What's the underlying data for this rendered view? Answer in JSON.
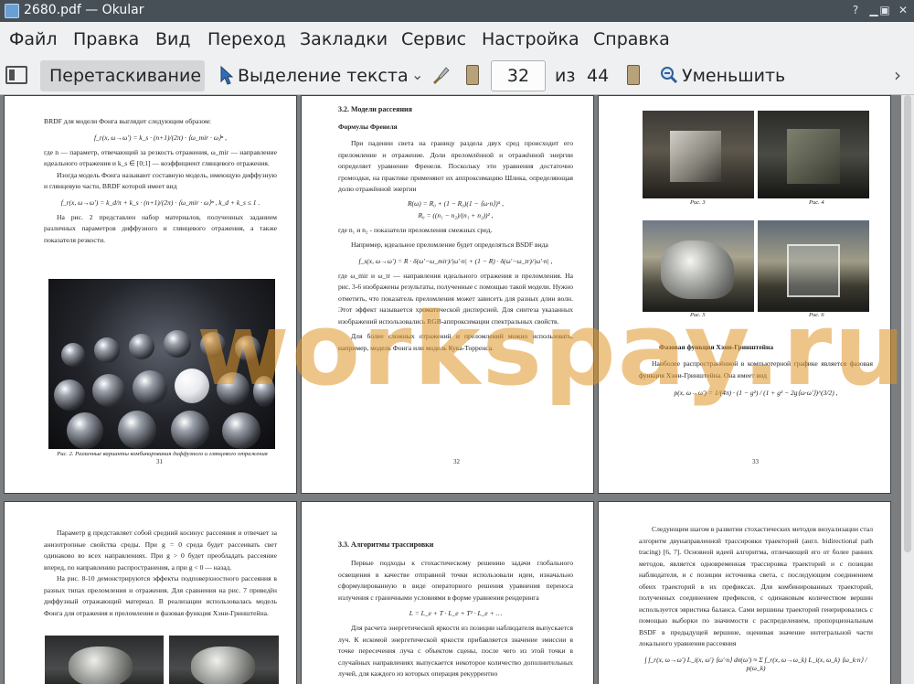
{
  "window": {
    "title": "2680.pdf  — Okular"
  },
  "menu": [
    "Файл",
    "Правка",
    "Вид",
    "Переход",
    "Закладки",
    "Сервис",
    "Настройка",
    "Справка"
  ],
  "toolbar": {
    "drag_label": "Перетаскивание",
    "select_label": "Выделение текста",
    "page_value": "32",
    "of_label": "из",
    "total_pages": "44",
    "zoom_label": "Уменьшить"
  },
  "pages": {
    "p31": {
      "para1": "BRDF для модели Фонга выглядит следующим образом:",
      "formula1": "f_r(x, ω→ω′) = k_s · (n+1)/(2π) · ⟨ω_mir · ω⟩ⁿ ,",
      "para2": "где n — параметр, отвечающий за резкость отражения, ω_mir — направление идеального отражения и k_s ∈ [0;1] — коэффициент глянцевого отражения.",
      "para3": "Изогда модель Фонга называют составную модель, имеющую диффузную и глянцевую части, BRDF которой имеет вид",
      "formula2": "f_r(x, ω→ω′) = k_d/π + k_s · (n+1)/(2π) · ⟨ω_mir · ω⟩ⁿ ,  k_d + k_s ≤ 1 .",
      "para4": "На рис. 2 представлен набор материалов, полученных заданием различных параметров диффузного и глянцевого отражения, а также показателя резкости.",
      "caption": "Рис. 2. Различные варианты комбинирования диффузного и глянцевого отражения",
      "number": "31"
    },
    "p32": {
      "section": "3.2. Модели рассеяния",
      "subsection": "Формулы Френеля",
      "para1": "При падении света на границу раздела двух сред происходит его преломление и отражение. Доли преломлённой и отражённой энергии определяет уравнение Френеля. Поскольку эти уравнения достаточно громоздки, на практике применяют их аппроксимацию Шлика, определяющая долю отражённой энергии",
      "formula1": "R(ω) = R₀ + (1 − R₀)(1 − ⟨ω·n⟩)⁵ ,",
      "formula2": "R₀ = ((n₁ − n₂)/(n₁ + n₂))² ,",
      "para2": "где n₁ и n₂ - показатели преломления смежных сред.",
      "para3": "Например, идеальное преломление будет определяться BSDF вида",
      "formula3": "f_s(x, ω→ω′) = R · δ(ω′−ω_mir)/|ω′·n| + (1 − R) · δ(ω′−ω_tr)/|ω′·n| ,",
      "para4": "где ω_mir и ω_tr — направления идеального отражения и преломления. На рис. 3-6 изображены результаты, полученные с помощью такой модели. Нужно отметить, что показатель преломления может зависеть для разных длин волн. Этот эффект называется хроматической дисперсией. Для синтеза указанных изображений использовались RGB-аппроксимации спектральных свойств.",
      "para5": "Для более сложных отражений и преломлений можно использовать, например, модель Фонга или модель Кука-Торренса.",
      "number": "32"
    },
    "p33": {
      "cap3": "Рис. 3",
      "cap4": "Рис. 4",
      "cap5": "Рис. 5",
      "cap6": "Рис. 6",
      "subsection": "Фазовая функция Хэни-Гринштейна",
      "para1": "Наиболее распространённой в компьютерной графике является фазовая функция Хэни-Гринштейна. Она имеет вид",
      "formula1": "p(x, ω→ω′) = 1/(4π) · (1 − g²) / (1 + g² − 2g⟨ω·ω′⟩)^(3/2) ,",
      "number": "33"
    },
    "p34": {
      "para1": "Параметр g представляет собой средний косинус рассеяния и отвечает за анизотропные свойства среды. При g = 0 среда будет рассеивать свет одинаково во всех направлениях. При g > 0 будет преобладать рассеяние вперед, по направлению распространения, а при g < 0 — назад.",
      "para2": "На рис. 8-10 демонстрируются эффекты подповерхностного рассеяния в разных типах преломления и отражения. Для сравнения на рис. 7 приведён диффузный отражающий материал. В реализации использовалась модель Фонга для отражения и преломления и фазовая функция Хэни-Гринштейна."
    },
    "p35": {
      "section": "3.3. Алгоритмы трассировки",
      "para1": "Первые подходы к стохастическому решению задачи глобального освещения в качестве отправной точки использовали идеи, изначально сформулированную в виде операторного решения уравнения переноса излучения с граничными условиями в форме уравнения рендеринга",
      "formula1": "L = L_e + T · L_e + T² · L_e + …",
      "para2": "Для расчета энергетической яркости из позиции наблюдателя выпускается луч. К искомой энергетической яркости прибавляется значение эмиссии в точке пересечения луча с объектом сцены, после чего из этой точки в случайных направлениях выпускается некоторое количество дополнительных лучей, для каждого из которых операция рекуррентно"
    },
    "p36": {
      "para1": "Следующим шагом в развитии стохастических методов визуализации стал алгоритм двунаправленной трассировки траекторий (англ. bidirectional path tracing) [6, 7]. Основной идеей алгоритма, отличающей его от более ранних методов, является одновременная трассировка траекторий и с позиции наблюдателя, и с позиции источника света, с последующим соединением обеих траекторий в их префиксах. Для комбинированных траекторий, полученных соединением префиксов, с одинаковым количеством вершин используется эвристика баланса. Сами вершины траекторий генерировались с помощью выборки по значимости с распределением, пропорциональным BSDF в предыдущей вершине, оценивая значение интегральной части локального уравнения рассеяния",
      "formula1": "∫ f_r(x, ω→ω′) L_i(x, ω′) ⟨ω′·n⟩ dσ(ω′) ≈ Σ f_r(x, ω→ω_k) L_i(x, ω_k) ⟨ω_k·n⟩ / p(ω_k)"
    }
  },
  "watermark": "workspay.ru"
}
